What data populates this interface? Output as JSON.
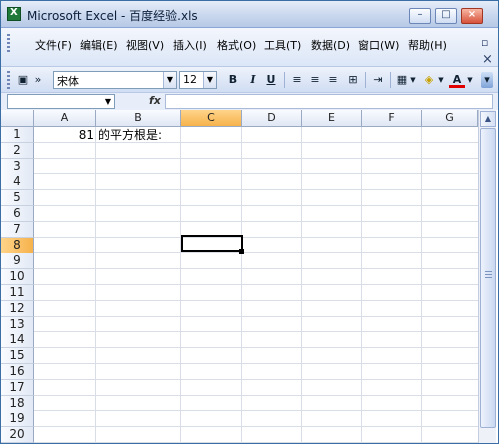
{
  "window": {
    "title": "Microsoft Excel - 百度经验.xls"
  },
  "window_buttons": {
    "minimize": "–",
    "maximize": "□",
    "close": "×"
  },
  "menu": {
    "items": [
      "文件(F)",
      "编辑(E)",
      "视图(V)",
      "插入(I)",
      "格式(O)",
      "工具(T)",
      "数据(D)",
      "窗口(W)",
      "帮助(H)"
    ],
    "restore_glyph": "▫",
    "close_glyph": "×"
  },
  "toolbar": {
    "font_name": "宋体",
    "font_size": "12",
    "bold": "B",
    "italic": "I",
    "underline": "U",
    "font_color_letter": "A"
  },
  "formula_bar": {
    "name_box_value": "",
    "fx_label": "fx",
    "formula_value": ""
  },
  "grid": {
    "columns": [
      "A",
      "B",
      "C",
      "D",
      "E",
      "F",
      "G"
    ],
    "rows": [
      "1",
      "2",
      "3",
      "4",
      "5",
      "6",
      "7",
      "8",
      "9",
      "10",
      "11",
      "12",
      "13",
      "14",
      "15",
      "16",
      "17",
      "18",
      "19",
      "20"
    ],
    "active_column": "C",
    "active_row": "8",
    "cells": {
      "A1": "81",
      "B1": "的平方根是:"
    }
  }
}
